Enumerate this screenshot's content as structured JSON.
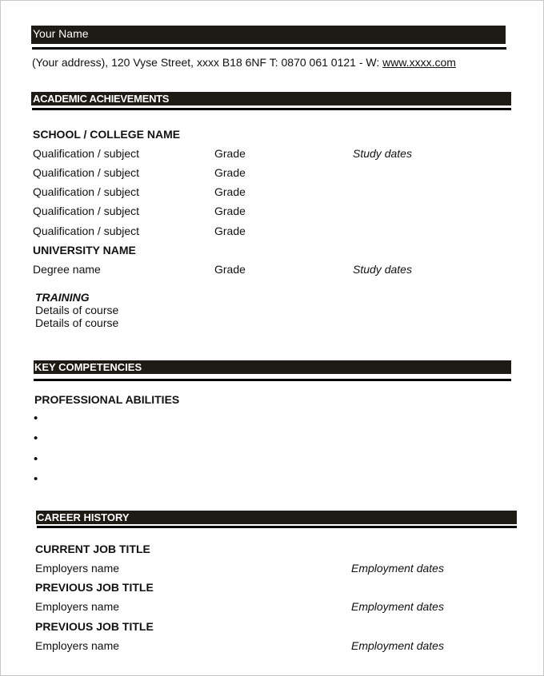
{
  "header": {
    "name": "Your Name",
    "contact_text": "(Your address), 120 Vyse Street, xxxx B18 6NF T: 0870 061 0121 - W: ",
    "website": "www.xxxx.com"
  },
  "academic": {
    "section_title": "ACADEMIC ACHIEVEMENTS",
    "school_name": "SCHOOL / COLLEGE NAME",
    "school_rows": [
      {
        "subject": "Qualification / subject",
        "grade": "Grade",
        "dates": "Study dates"
      },
      {
        "subject": "Qualification / subject",
        "grade": "Grade",
        "dates": ""
      },
      {
        "subject": "Qualification / subject",
        "grade": "Grade",
        "dates": ""
      },
      {
        "subject": "Qualification / subject",
        "grade": "Grade",
        "dates": ""
      },
      {
        "subject": "Qualification / subject",
        "grade": "Grade",
        "dates": ""
      }
    ],
    "university_name": "UNIVERSITY NAME",
    "university_row": {
      "degree": "Degree name",
      "grade": "Grade",
      "dates": "Study dates"
    },
    "training": {
      "title": "TRAINING",
      "courses": [
        "Details of course",
        "Details of course"
      ]
    }
  },
  "competencies": {
    "section_title": "KEY COMPETENCIES",
    "subtitle": "PROFESSIONAL ABILITIES",
    "bullets": [
      "",
      "",
      "",
      ""
    ],
    "bullet_glyph": "•"
  },
  "career": {
    "section_title": "CAREER HISTORY",
    "jobs": [
      {
        "title": "CURRENT JOB TITLE",
        "employer": "Employers name",
        "dates": "Employment dates"
      },
      {
        "title": "PREVIOUS JOB TITLE",
        "employer": "Employers name",
        "dates": "Employment dates"
      },
      {
        "title": "PREVIOUS JOB TITLE",
        "employer": "Employers name",
        "dates": "Employment dates"
      }
    ]
  }
}
